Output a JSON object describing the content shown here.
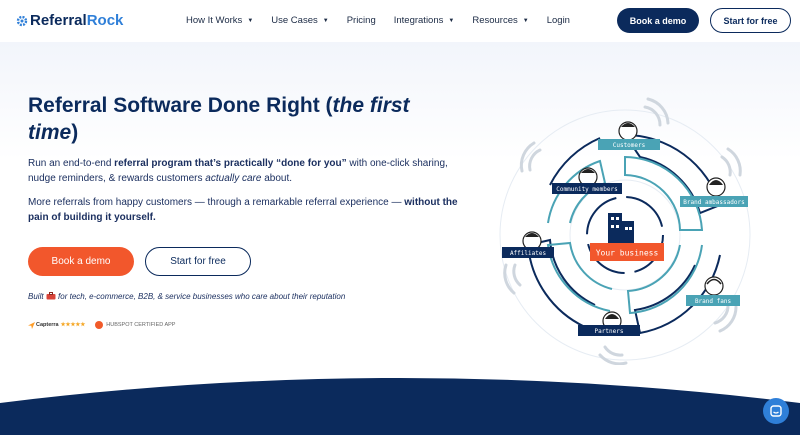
{
  "brand": {
    "name_part1": "Referral",
    "name_part2": "Rock"
  },
  "nav": {
    "items": [
      {
        "label": "How It Works",
        "caret": true
      },
      {
        "label": "Use Cases",
        "caret": true
      },
      {
        "label": "Pricing",
        "caret": false
      },
      {
        "label": "Integrations",
        "caret": true
      },
      {
        "label": "Resources",
        "caret": true
      },
      {
        "label": "Login",
        "caret": false
      }
    ],
    "book_demo": "Book a demo",
    "start_free": "Start for free"
  },
  "hero": {
    "headline_main": "Referral Software Done Right (",
    "headline_em": "the first time",
    "headline_end": ")",
    "p1_a": "Run an end-to-end ",
    "p1_b": "referral program that’s practically “done for you”",
    "p1_c": " with one-click sharing, nudge reminders, & rewards customers ",
    "p1_d": "actually care",
    "p1_e": " about.",
    "p2_a": "More referrals from happy customers — through a remarkable referral experience — ",
    "p2_b": "without the pain of building it yourself.",
    "btn_demo": "Book a demo",
    "btn_start": "Start for free",
    "built_a": "Built",
    "built_b": "for tech, e-commerce, B2B, & service businesses who care about their reputation",
    "capterra": "Capterra",
    "stars": "★★★★★",
    "hubspot": "HUBSPOT CERTIFIED APP"
  },
  "diagram": {
    "center": "Your business",
    "labels": [
      "Customers",
      "Community members",
      "Brand ambassadors",
      "Affiliates",
      "Brand fans",
      "Partners"
    ]
  },
  "colors": {
    "navy": "#0b2a5c",
    "orange": "#f2572c",
    "teal": "#4aa3b5",
    "blue": "#2f7fd8"
  }
}
